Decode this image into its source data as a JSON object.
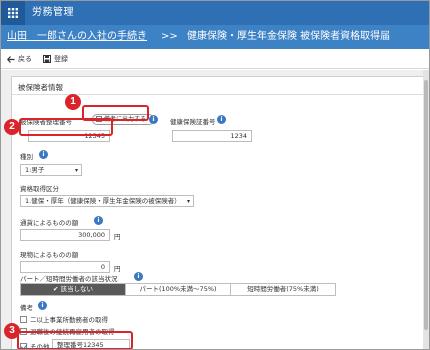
{
  "app": {
    "title": "労務管理"
  },
  "subheader": {
    "link": "山田　一郎さんの入社の手続き",
    "separator": ">>",
    "page": "健康保険・厚生年金保険 被保険者資格取得届"
  },
  "toolbar": {
    "back_label": "戻る",
    "register_label": "登録"
  },
  "panel": {
    "title": "被保険者情報",
    "insured_number": {
      "label": "被保険者整理番号",
      "print_option": "備考に出力する",
      "value": "12345"
    },
    "card_number": {
      "label": "健康保険証番号",
      "value": "1234"
    },
    "kind": {
      "label": "種別",
      "selected": "1:男子"
    },
    "qualification": {
      "label": "資格取得区分",
      "selected": "1.健保・厚年（健康保険・厚生年金保険の被保険者）"
    },
    "currency_pay": {
      "label": "通貨によるものの額",
      "value": "300,000",
      "unit": "円"
    },
    "inkind_pay": {
      "label": "現物によるものの額",
      "value": "0",
      "unit": "円"
    },
    "parttime": {
      "label": "パート／短時間労働者の該当状況",
      "options": [
        "✔ 該当しない",
        "パート(100%未満〜75%)",
        "短時間労働者(75%未満)"
      ],
      "selected_index": 0
    },
    "remarks": {
      "label": "備考",
      "items": [
        {
          "label": "二以上事業所勤務者の取得",
          "checked": false
        },
        {
          "label": "退職後の継続再雇用者の取得",
          "checked": false
        }
      ],
      "other": {
        "label": "その他",
        "checked": true,
        "value": "整理番号12345"
      }
    }
  },
  "callouts": [
    "1",
    "2",
    "3"
  ],
  "colors": {
    "header": "#2f6fb4",
    "subheader": "#3e82c6",
    "accent": "#3b78c2",
    "callout": "#d9242b"
  }
}
